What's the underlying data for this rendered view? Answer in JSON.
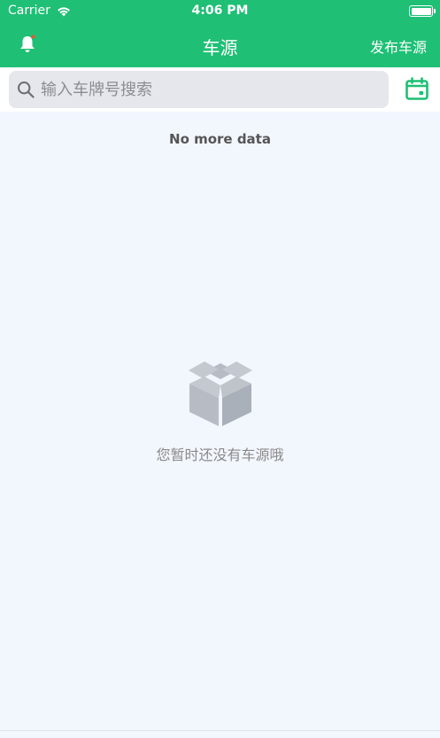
{
  "status_bar": {
    "carrier": "Carrier",
    "time": "4:06 PM"
  },
  "nav": {
    "title": "车源",
    "action_label": "发布车源",
    "left_icon": "bell-icon",
    "accent_color": "#1fbf75"
  },
  "search": {
    "placeholder": "输入车牌号搜索",
    "value": "",
    "right_icon": "calendar-icon"
  },
  "list": {
    "footer_text": "No more data"
  },
  "empty_state": {
    "icon": "empty-box-icon",
    "message": "您暂时还没有车源哦"
  }
}
